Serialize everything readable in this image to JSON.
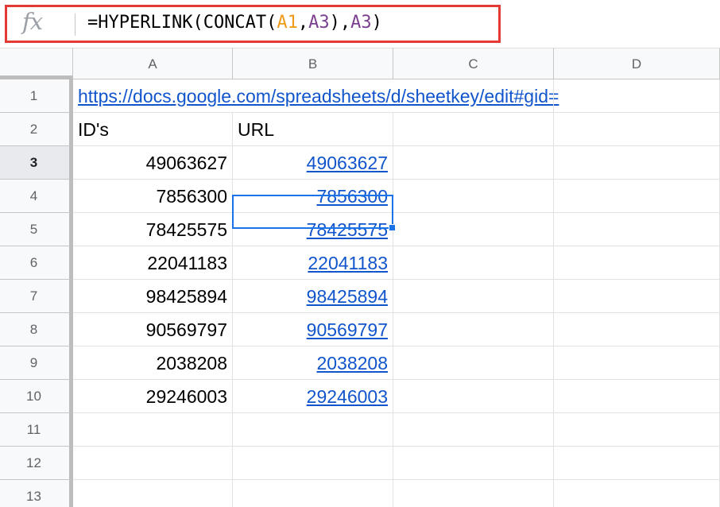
{
  "formula_bar": {
    "fx_label": "fx",
    "formula_prefix": "=HYPERLINK(CONCAT(",
    "formula_ref1": "A1",
    "formula_comma1": ",",
    "formula_ref2": "A3",
    "formula_mid": "),",
    "formula_ref3": "A3",
    "formula_suffix": ")",
    "highlight_color": "#e53935"
  },
  "grid": {
    "columns": [
      "A",
      "B",
      "C",
      "D"
    ],
    "rows": [
      {
        "num": "1",
        "a": "https://docs.google.com/spreadsheets/d/sheetkey/edit#gid=",
        "b": ""
      },
      {
        "num": "2",
        "a": "ID's",
        "b": "URL"
      },
      {
        "num": "3",
        "a": "49063627",
        "b": "49063627"
      },
      {
        "num": "4",
        "a": "7856300",
        "b": "7856300"
      },
      {
        "num": "5",
        "a": "78425575",
        "b": "78425575"
      },
      {
        "num": "6",
        "a": "22041183",
        "b": "22041183"
      },
      {
        "num": "7",
        "a": "98425894",
        "b": "98425894"
      },
      {
        "num": "8",
        "a": "90569797",
        "b": "90569797"
      },
      {
        "num": "9",
        "a": "2038208",
        "b": "2038208"
      },
      {
        "num": "10",
        "a": "29246003",
        "b": "29246003"
      },
      {
        "num": "11",
        "a": "",
        "b": ""
      },
      {
        "num": "12",
        "a": "",
        "b": ""
      },
      {
        "num": "13",
        "a": "",
        "b": ""
      }
    ],
    "selected_cell": "B3",
    "link_color": "#1155cc",
    "selection_color": "#1a73e8"
  }
}
